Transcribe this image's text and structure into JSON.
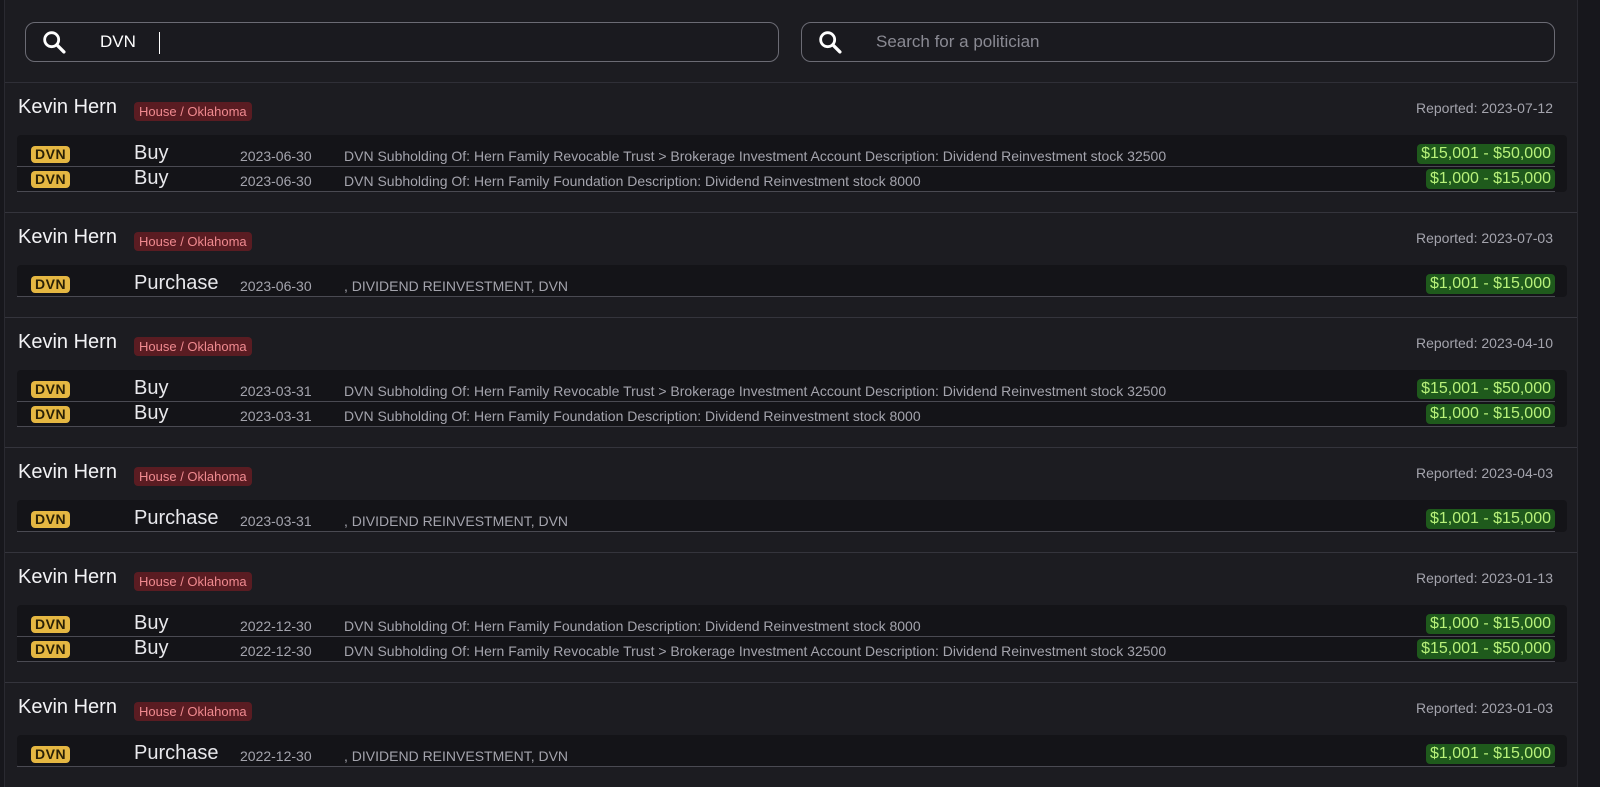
{
  "search": {
    "ticker_value": "DVN",
    "politician_placeholder": "Search for a politician"
  },
  "groups": [
    {
      "politician": "Kevin Hern",
      "chamber": "House / Oklahoma",
      "reported": "Reported: 2023-07-12",
      "trades": [
        {
          "ticker": "DVN",
          "type": "Buy",
          "date": "2023-06-30",
          "desc": "DVN Subholding Of: Hern Family Revocable Trust > Brokerage Investment Account Description: Dividend Reinvestment stock 32500",
          "amount": "$15,001 - $50,000"
        },
        {
          "ticker": "DVN",
          "type": "Buy",
          "date": "2023-06-30",
          "desc": "DVN Subholding Of: Hern Family Foundation Description: Dividend Reinvestment stock 8000",
          "amount": "$1,000 - $15,000"
        }
      ]
    },
    {
      "politician": "Kevin Hern",
      "chamber": "House / Oklahoma",
      "reported": "Reported: 2023-07-03",
      "trades": [
        {
          "ticker": "DVN",
          "type": "Purchase",
          "date": "2023-06-30",
          "desc": ", DIVIDEND REINVESTMENT, DVN",
          "amount": "$1,001 - $15,000"
        }
      ]
    },
    {
      "politician": "Kevin Hern",
      "chamber": "House / Oklahoma",
      "reported": "Reported: 2023-04-10",
      "trades": [
        {
          "ticker": "DVN",
          "type": "Buy",
          "date": "2023-03-31",
          "desc": "DVN Subholding Of: Hern Family Revocable Trust > Brokerage Investment Account Description: Dividend Reinvestment stock 32500",
          "amount": "$15,001 - $50,000"
        },
        {
          "ticker": "DVN",
          "type": "Buy",
          "date": "2023-03-31",
          "desc": "DVN Subholding Of: Hern Family Foundation Description: Dividend Reinvestment stock 8000",
          "amount": "$1,000 - $15,000"
        }
      ]
    },
    {
      "politician": "Kevin Hern",
      "chamber": "House / Oklahoma",
      "reported": "Reported: 2023-04-03",
      "trades": [
        {
          "ticker": "DVN",
          "type": "Purchase",
          "date": "2023-03-31",
          "desc": ", DIVIDEND REINVESTMENT, DVN",
          "amount": "$1,001 - $15,000"
        }
      ]
    },
    {
      "politician": "Kevin Hern",
      "chamber": "House / Oklahoma",
      "reported": "Reported: 2023-01-13",
      "trades": [
        {
          "ticker": "DVN",
          "type": "Buy",
          "date": "2022-12-30",
          "desc": "DVN Subholding Of: Hern Family Foundation Description: Dividend Reinvestment stock 8000",
          "amount": "$1,000 - $15,000"
        },
        {
          "ticker": "DVN",
          "type": "Buy",
          "date": "2022-12-30",
          "desc": "DVN Subholding Of: Hern Family Revocable Trust > Brokerage Investment Account Description: Dividend Reinvestment stock 32500",
          "amount": "$15,001 - $50,000"
        }
      ]
    },
    {
      "politician": "Kevin Hern",
      "chamber": "House / Oklahoma",
      "reported": "Reported: 2023-01-03",
      "trades": [
        {
          "ticker": "DVN",
          "type": "Purchase",
          "date": "2022-12-30",
          "desc": ", DIVIDEND REINVESTMENT, DVN",
          "amount": "$1,001 - $15,000"
        }
      ]
    }
  ]
}
